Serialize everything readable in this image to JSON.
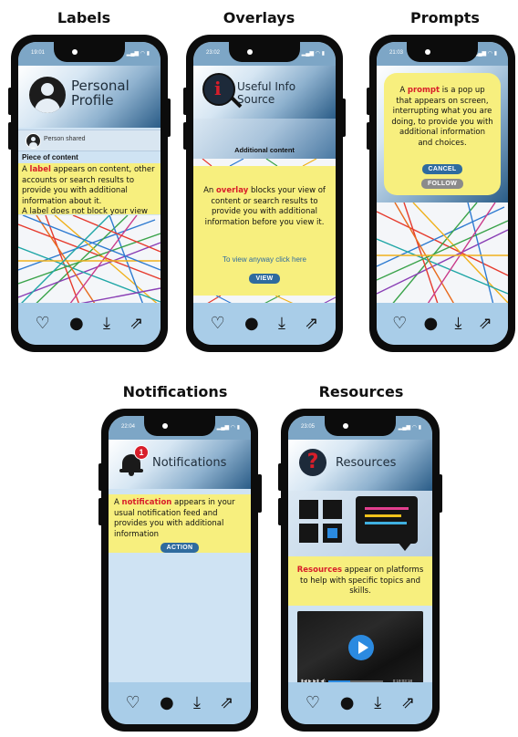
{
  "titles": {
    "labels": "Labels",
    "overlays": "Overlays",
    "prompts": "Prompts",
    "notifications": "Notifications",
    "resources": "Resources"
  },
  "phones": {
    "labels": {
      "time": "19:01",
      "header": "Personal Profile",
      "person_shared": "Person shared",
      "piece_heading": "Piece of content",
      "text_lead": "A ",
      "text_highlight": "label",
      "text_rest": " appears on content, other accounts or search results to provide you with additional information about it.",
      "text_note": "A label does not block your view"
    },
    "overlays": {
      "time": "23:02",
      "header": "Useful Info Source",
      "additional_content": "Additional content",
      "text_lead": "An ",
      "text_highlight": "overlay",
      "text_rest": " blocks your view of content or search results to provide you with additional information before you view it.",
      "view_anyway": "To view anyway click here",
      "view_button": "VIEW"
    },
    "prompts": {
      "time": "21:03",
      "text_lead": "A ",
      "text_highlight": "prompt",
      "text_rest": " is a pop up that appears on screen, interrupting what you are doing, to provide you with additional information and choices.",
      "cancel_button": "CANCEL",
      "follow_button": "FOLLOW"
    },
    "notifications": {
      "time": "22:04",
      "badge": "1",
      "header": "Notifications",
      "text_lead": "A ",
      "text_highlight": "notification",
      "text_rest": " appears in your usual notification feed and provides you with additional information",
      "action_button": "ACTION"
    },
    "resources": {
      "time": "23:05",
      "header": "Resources",
      "question_mark": "?",
      "text_highlight": "Resources",
      "text_rest": " appear on platforms to help with specific topics and skills.",
      "video_time": "0:19:03:18"
    }
  },
  "nav_icons": [
    "heart-add-icon",
    "chat-bubble-icon",
    "download-icon",
    "share-icon"
  ],
  "colors": {
    "highlight": "#d81e2a",
    "yellow": "#f7ef7e",
    "button_blue": "#2f6b9e",
    "navbar": "#a9cde8"
  }
}
